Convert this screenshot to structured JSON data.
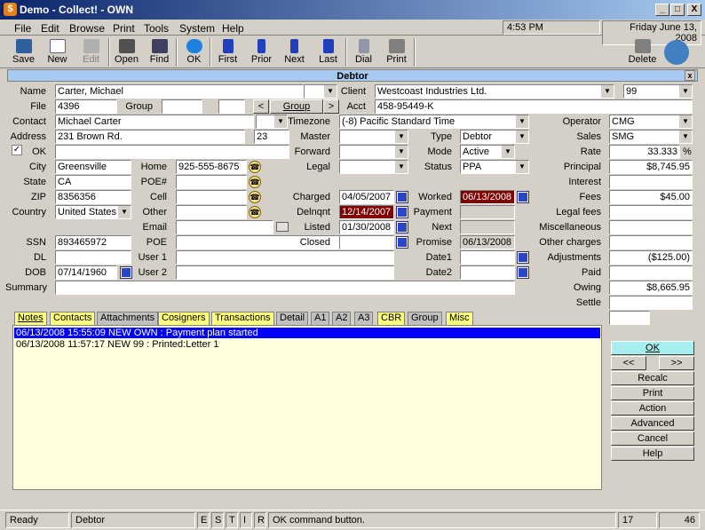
{
  "window": {
    "title": "Demo - Collect! - OWN",
    "min": "_",
    "max": "□",
    "close": "X"
  },
  "menu": [
    "File",
    "Edit",
    "Browse",
    "Print",
    "Tools",
    "System",
    "Help"
  ],
  "clock": {
    "time": "4:53 PM",
    "date": "Friday  June 13, 2008"
  },
  "toolbar": {
    "save": "Save",
    "new": "New",
    "edit": "Edit",
    "open": "Open",
    "find": "Find",
    "ok": "OK",
    "first": "First",
    "prior": "Prior",
    "next": "Next",
    "last": "Last",
    "dial": "Dial",
    "print": "Print",
    "delete": "Delete"
  },
  "panel": {
    "title": "Debtor",
    "close": "x"
  },
  "labels": {
    "name": "Name",
    "file": "File",
    "group": "Group",
    "contact": "Contact",
    "address": "Address",
    "ok": "OK",
    "city": "City",
    "state": "State",
    "zip": "ZIP",
    "country": "Country",
    "ssn": "SSN",
    "dl": "DL",
    "dob": "DOB",
    "summary": "Summary",
    "home": "Home",
    "poe_num": "POE#",
    "cell": "Cell",
    "other": "Other",
    "email": "Email",
    "poe": "POE",
    "user1": "User 1",
    "user2": "User 2",
    "client": "Client",
    "acct": "Acct",
    "timezone": "Timezone",
    "master": "Master",
    "forward": "Forward",
    "legal": "Legal",
    "charged": "Charged",
    "delnqnt": "Delnqnt",
    "listed": "Listed",
    "closed": "Closed",
    "type": "Type",
    "mode": "Mode",
    "status": "Status",
    "worked": "Worked",
    "payment": "Payment",
    "next": "Next",
    "promise": "Promise",
    "date1": "Date1",
    "date2": "Date2",
    "operator": "Operator",
    "sales": "Sales",
    "rate": "Rate",
    "principal": "Principal",
    "interest": "Interest",
    "fees": "Fees",
    "legal_fees": "Legal fees",
    "miscellaneous": "Miscellaneous",
    "other_charges": "Other charges",
    "adjustments": "Adjustments",
    "paid": "Paid",
    "owing": "Owing",
    "settle": "Settle",
    "group_btn": "Group",
    "prev_btn": "<",
    "next_btn": ">"
  },
  "values": {
    "name": "Carter, Michael",
    "file": "4396",
    "contact": "Michael Carter",
    "address": "231 Brown Rd.",
    "apt": "23",
    "city": "Greensville",
    "state": "CA",
    "zip": "8356356",
    "country": "United States",
    "ssn": "893465972",
    "dob": "07/14/1960",
    "home": "925-555-8675",
    "client": "Westcoast Industries Ltd.",
    "client_num": "99",
    "acct": "458-95449-K",
    "timezone": "(-8) Pacific Standard Time",
    "charged": "04/05/2007",
    "delnqnt": "12/14/2007",
    "listed": "01/30/2008",
    "type": "Debtor",
    "mode": "Active",
    "status": "PPA",
    "worked": "06/13/2008",
    "promise": "06/13/2008",
    "operator": "CMG",
    "sales": "SMG",
    "rate": "33.333",
    "rate_unit": "%",
    "principal": "$8,745.95",
    "fees": "$45.00",
    "adjustments": "($125.00)",
    "owing": "$8,665.95",
    "ok_check": "✓"
  },
  "tabs": [
    "Notes",
    "Contacts",
    "Attachments",
    "Cosigners",
    "Transactions",
    "Detail",
    "A1",
    "A2",
    "A3",
    "CBR",
    "Group",
    "Misc"
  ],
  "notes": [
    "06/13/2008 15:55:09 NEW OWN : Payment plan started",
    "06/13/2008 11:57:17 NEW 99 : Printed:Letter 1"
  ],
  "actions": {
    "ok": "OK",
    "prev": "<<",
    "next": ">>",
    "recalc": "Recalc",
    "print": "Print",
    "action": "Action",
    "advanced": "Advanced",
    "cancel": "Cancel",
    "help": "Help"
  },
  "status": {
    "ready": "Ready",
    "context": "Debtor",
    "e": "E",
    "s": "S",
    "t": "T",
    "i": "I",
    "r": "R",
    "message": "OK command button.",
    "n1": "17",
    "n2": "46"
  },
  "colors": {
    "title_start": "#0a246a",
    "title_end": "#a6caf0",
    "selected": "#0000ff",
    "notes_bg": "#ffffe0",
    "date_red": "#800000"
  }
}
